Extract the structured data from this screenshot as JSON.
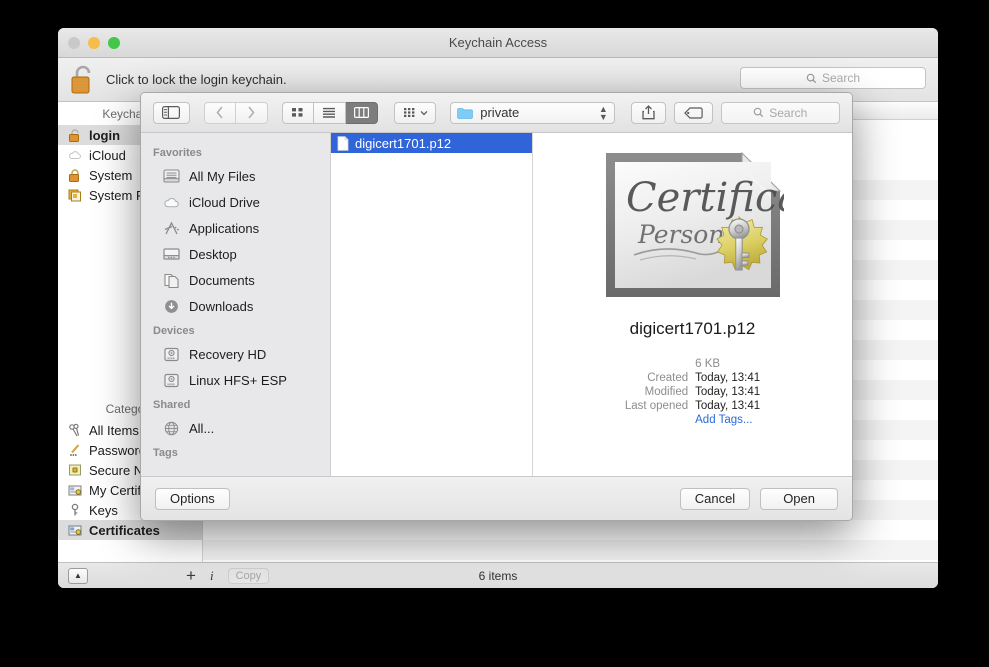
{
  "keychain_window": {
    "title": "Keychain Access",
    "traffic_lights": [
      "close-button",
      "minimize-button",
      "zoom-button"
    ],
    "toolbar": {
      "lock_icon": "unlocked-padlock-icon",
      "lock_message": "Click to lock the login keychain.",
      "search": {
        "icon": "search-icon",
        "placeholder": "Search",
        "value": ""
      }
    },
    "sidebar": {
      "keychains_header": "Keychains",
      "keychains": [
        {
          "label": "login",
          "icon": "unlocked-padlock-icon",
          "selected": true
        },
        {
          "label": "iCloud",
          "icon": "cloud-icon",
          "selected": false
        },
        {
          "label": "System",
          "icon": "locked-padlock-icon",
          "selected": false
        },
        {
          "label": "System Roots",
          "icon": "certificate-stack-icon",
          "selected": false
        }
      ],
      "category_header": "Category",
      "categories": [
        {
          "label": "All Items",
          "icon": "keys-icon",
          "selected": false
        },
        {
          "label": "Passwords",
          "icon": "pencil-icon",
          "selected": false
        },
        {
          "label": "Secure Notes",
          "icon": "yellow-lock-icon",
          "selected": false
        },
        {
          "label": "My Certificates",
          "icon": "my-certificate-icon",
          "selected": false
        },
        {
          "label": "Keys",
          "icon": "key-icon",
          "selected": false
        },
        {
          "label": "Certificates",
          "icon": "certificate-icon",
          "selected": true
        }
      ]
    },
    "status_bar": {
      "toggle_icon": "show-hide-detail-icon",
      "add_label": "+",
      "info_label": "i",
      "copy_label": "Copy",
      "item_count": "6 items"
    }
  },
  "open_dialog": {
    "toolbar": {
      "sidebar_toggle": "sidebar-toggle-icon",
      "back": "chevron-left-icon",
      "forward": "chevron-right-icon",
      "view_icon": "icon-view-icon",
      "view_list": "list-view-icon",
      "view_column": "column-view-icon",
      "active_view": "column",
      "arrange_icon": "arrange-by-icon",
      "path": {
        "folder_icon": "folder-icon",
        "label": "private"
      },
      "share_icon": "share-icon",
      "tag_icon": "tag-icon",
      "search": {
        "icon": "search-icon",
        "placeholder": "Search",
        "value": ""
      }
    },
    "sidebar": {
      "sections": [
        {
          "header": "Favorites",
          "items": [
            {
              "label": "All My Files",
              "icon": "all-my-files-icon"
            },
            {
              "label": "iCloud Drive",
              "icon": "cloud-icon"
            },
            {
              "label": "Applications",
              "icon": "applications-icon"
            },
            {
              "label": "Desktop",
              "icon": "desktop-icon"
            },
            {
              "label": "Documents",
              "icon": "documents-icon"
            },
            {
              "label": "Downloads",
              "icon": "downloads-icon"
            }
          ]
        },
        {
          "header": "Devices",
          "items": [
            {
              "label": "Recovery HD",
              "icon": "hard-drive-icon"
            },
            {
              "label": "Linux HFS+ ESP",
              "icon": "hard-drive-icon"
            }
          ]
        },
        {
          "header": "Shared",
          "items": [
            {
              "label": "All...",
              "icon": "globe-icon"
            }
          ]
        },
        {
          "header": "Tags",
          "items": []
        }
      ]
    },
    "file_list": [
      {
        "name": "digicert1701.p12",
        "icon": "document-icon",
        "selected": true
      }
    ],
    "preview": {
      "icon": "personal-certificate-icon",
      "icon_text_main": "Certificae",
      "icon_text_sub": "Personal",
      "name": "digicert1701.p12",
      "size": "6 KB",
      "fields": [
        {
          "key": "Created",
          "value": "Today, 13:41"
        },
        {
          "key": "Modified",
          "value": "Today, 13:41"
        },
        {
          "key": "Last opened",
          "value": "Today, 13:41"
        }
      ],
      "add_tags": "Add Tags..."
    },
    "footer": {
      "options_label": "Options",
      "cancel_label": "Cancel",
      "open_label": "Open"
    }
  },
  "colors": {
    "selection_blue": "#2f65d8",
    "link_blue": "#2a6bd8",
    "window_chrome": "#e9e9e9",
    "desktop": "#000000"
  }
}
